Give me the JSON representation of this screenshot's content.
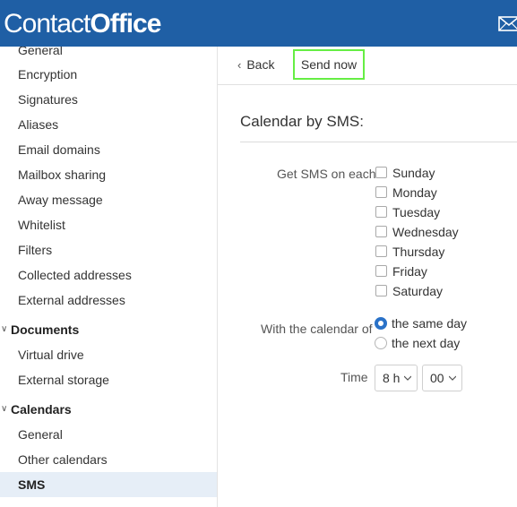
{
  "header": {
    "brand_light": "Contact",
    "brand_bold": "Office",
    "bg_color": "#1f5fa5"
  },
  "sidebar": {
    "mail_items": [
      "General",
      "Encryption",
      "Signatures",
      "Aliases",
      "Email domains",
      "Mailbox sharing",
      "Away message",
      "Whitelist",
      "Filters",
      "Collected addresses",
      "External addresses"
    ],
    "documents_title": "Documents",
    "documents_items": [
      "Virtual drive",
      "External storage"
    ],
    "calendars_title": "Calendars",
    "calendars_items": [
      "General",
      "Other calendars",
      "SMS"
    ],
    "active_item": "SMS"
  },
  "toolbar": {
    "back_label": "Back",
    "send_label": "Send now"
  },
  "main": {
    "title": "Calendar by SMS: ",
    "get_sms_label": "Get SMS on each",
    "days": [
      "Sunday",
      "Monday",
      "Tuesday",
      "Wednesday",
      "Thursday",
      "Friday",
      "Saturday"
    ],
    "calendar_of_label": "With the calendar of",
    "calendar_options": [
      "the same day",
      "the next day"
    ],
    "selected_calendar_option": "the same day",
    "time_label": "Time",
    "hour_value": "8 h",
    "minute_value": "00"
  }
}
